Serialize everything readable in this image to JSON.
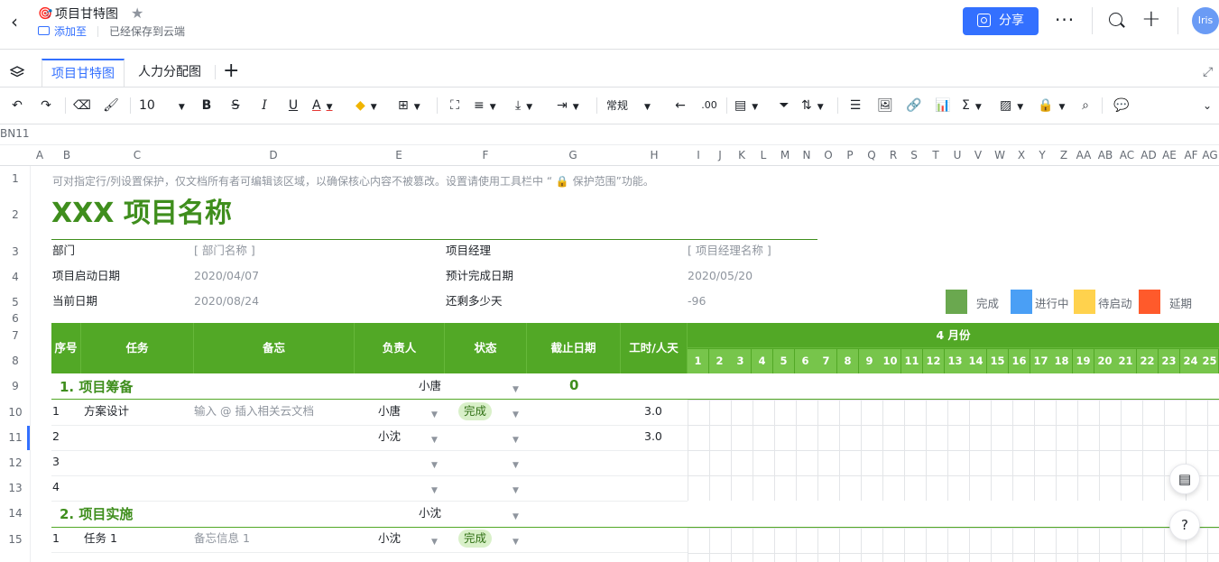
{
  "topbar": {
    "title": "项目甘特图",
    "add_to": "添加至",
    "saved": "已经保存到云端",
    "share": "分享",
    "avatar": "Iris"
  },
  "tabs": [
    "项目甘特图",
    "人力分配图"
  ],
  "toolbar": {
    "font_size": "10",
    "format": "常规"
  },
  "namebox": "BN11",
  "columns": [
    "A",
    "B",
    "C",
    "D",
    "E",
    "F",
    "G",
    "H",
    "I",
    "J",
    "K",
    "L",
    "M",
    "N",
    "O",
    "P",
    "Q",
    "R",
    "S",
    "T",
    "U",
    "V",
    "W",
    "X",
    "Y",
    "Z",
    "AA",
    "AB",
    "AC",
    "AD",
    "AE",
    "AF",
    "AG"
  ],
  "rows": [
    "1",
    "2",
    "3",
    "4",
    "5",
    "6",
    "7",
    "8",
    "9",
    "10",
    "11",
    "12",
    "13",
    "14",
    "15"
  ],
  "sheet": {
    "notice": "可对指定行/列设置保护，仅文档所有者可编辑该区域，以确保核心内容不被篡改。设置请使用工具栏中 “ 🔒 保护范围”功能。",
    "project_title": "XXX 项目名称",
    "dept_label": "部门",
    "dept_value": "[ 部门名称 ]",
    "pm_label": "项目经理",
    "pm_value": "[ 项目经理名称 ]",
    "start_label": "项目启动日期",
    "start_value": "2020/04/07",
    "finish_label": "预计完成日期",
    "finish_value": "2020/05/20",
    "today_label": "当前日期",
    "today_value": "2020/08/24",
    "remain_label": "还剩多少天",
    "remain_value": "-96"
  },
  "legend": [
    {
      "label": "完成",
      "color": "#6aa84f"
    },
    {
      "label": "进行中",
      "color": "#4a9ff5"
    },
    {
      "label": "待启动",
      "color": "#ffd24d"
    },
    {
      "label": "延期",
      "color": "#ff5a2b"
    }
  ],
  "table": {
    "headers": {
      "seq": "序号",
      "task": "任务",
      "note": "备忘",
      "owner": "负责人",
      "status": "状态",
      "due": "截止日期",
      "hours": "工时/人天"
    },
    "month": "4 月份",
    "days": [
      "1",
      "2",
      "3",
      "4",
      "5",
      "6",
      "7",
      "8",
      "9",
      "10",
      "11",
      "12",
      "13",
      "14",
      "15",
      "16",
      "17",
      "18",
      "19",
      "20",
      "21",
      "22",
      "23",
      "24",
      "25"
    ],
    "section1": {
      "title": "1. 项目筹备",
      "owner": "小唐",
      "due": "0"
    },
    "r10": {
      "seq": "1",
      "task": "方案设计",
      "note": "输入 @ 插入相关云文档",
      "owner": "小唐",
      "status": "完成",
      "hours": "3.0"
    },
    "r11": {
      "seq": "2",
      "owner": "小沈",
      "hours": "3.0"
    },
    "r12": {
      "seq": "3"
    },
    "r13": {
      "seq": "4"
    },
    "section2": {
      "title": "2. 项目实施",
      "owner": "小沈"
    },
    "r15": {
      "seq": "1",
      "task": "任务 1",
      "note": "备忘信息 1",
      "owner": "小沈",
      "status": "完成"
    }
  }
}
